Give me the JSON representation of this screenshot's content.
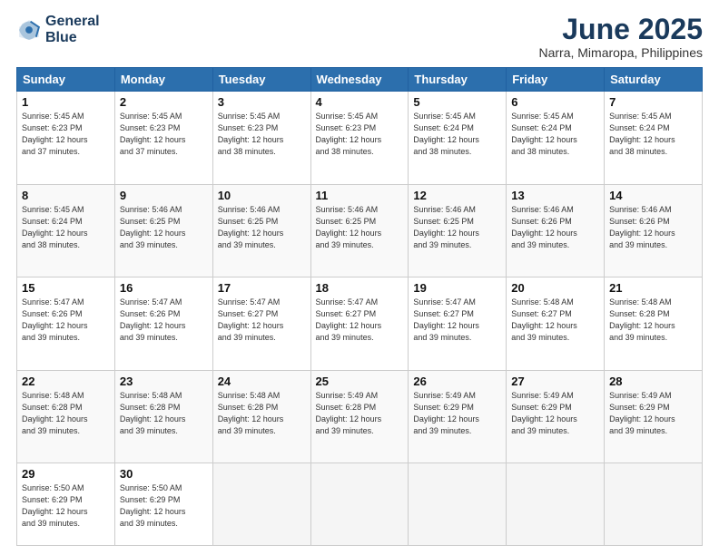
{
  "logo": {
    "line1": "General",
    "line2": "Blue"
  },
  "title": "June 2025",
  "location": "Narra, Mimaropa, Philippines",
  "headers": [
    "Sunday",
    "Monday",
    "Tuesday",
    "Wednesday",
    "Thursday",
    "Friday",
    "Saturday"
  ],
  "weeks": [
    [
      {
        "day": "1",
        "detail": "Sunrise: 5:45 AM\nSunset: 6:23 PM\nDaylight: 12 hours\nand 37 minutes."
      },
      {
        "day": "2",
        "detail": "Sunrise: 5:45 AM\nSunset: 6:23 PM\nDaylight: 12 hours\nand 37 minutes."
      },
      {
        "day": "3",
        "detail": "Sunrise: 5:45 AM\nSunset: 6:23 PM\nDaylight: 12 hours\nand 38 minutes."
      },
      {
        "day": "4",
        "detail": "Sunrise: 5:45 AM\nSunset: 6:23 PM\nDaylight: 12 hours\nand 38 minutes."
      },
      {
        "day": "5",
        "detail": "Sunrise: 5:45 AM\nSunset: 6:24 PM\nDaylight: 12 hours\nand 38 minutes."
      },
      {
        "day": "6",
        "detail": "Sunrise: 5:45 AM\nSunset: 6:24 PM\nDaylight: 12 hours\nand 38 minutes."
      },
      {
        "day": "7",
        "detail": "Sunrise: 5:45 AM\nSunset: 6:24 PM\nDaylight: 12 hours\nand 38 minutes."
      }
    ],
    [
      {
        "day": "8",
        "detail": "Sunrise: 5:45 AM\nSunset: 6:24 PM\nDaylight: 12 hours\nand 38 minutes."
      },
      {
        "day": "9",
        "detail": "Sunrise: 5:46 AM\nSunset: 6:25 PM\nDaylight: 12 hours\nand 39 minutes."
      },
      {
        "day": "10",
        "detail": "Sunrise: 5:46 AM\nSunset: 6:25 PM\nDaylight: 12 hours\nand 39 minutes."
      },
      {
        "day": "11",
        "detail": "Sunrise: 5:46 AM\nSunset: 6:25 PM\nDaylight: 12 hours\nand 39 minutes."
      },
      {
        "day": "12",
        "detail": "Sunrise: 5:46 AM\nSunset: 6:25 PM\nDaylight: 12 hours\nand 39 minutes."
      },
      {
        "day": "13",
        "detail": "Sunrise: 5:46 AM\nSunset: 6:26 PM\nDaylight: 12 hours\nand 39 minutes."
      },
      {
        "day": "14",
        "detail": "Sunrise: 5:46 AM\nSunset: 6:26 PM\nDaylight: 12 hours\nand 39 minutes."
      }
    ],
    [
      {
        "day": "15",
        "detail": "Sunrise: 5:47 AM\nSunset: 6:26 PM\nDaylight: 12 hours\nand 39 minutes."
      },
      {
        "day": "16",
        "detail": "Sunrise: 5:47 AM\nSunset: 6:26 PM\nDaylight: 12 hours\nand 39 minutes."
      },
      {
        "day": "17",
        "detail": "Sunrise: 5:47 AM\nSunset: 6:27 PM\nDaylight: 12 hours\nand 39 minutes."
      },
      {
        "day": "18",
        "detail": "Sunrise: 5:47 AM\nSunset: 6:27 PM\nDaylight: 12 hours\nand 39 minutes."
      },
      {
        "day": "19",
        "detail": "Sunrise: 5:47 AM\nSunset: 6:27 PM\nDaylight: 12 hours\nand 39 minutes."
      },
      {
        "day": "20",
        "detail": "Sunrise: 5:48 AM\nSunset: 6:27 PM\nDaylight: 12 hours\nand 39 minutes."
      },
      {
        "day": "21",
        "detail": "Sunrise: 5:48 AM\nSunset: 6:28 PM\nDaylight: 12 hours\nand 39 minutes."
      }
    ],
    [
      {
        "day": "22",
        "detail": "Sunrise: 5:48 AM\nSunset: 6:28 PM\nDaylight: 12 hours\nand 39 minutes."
      },
      {
        "day": "23",
        "detail": "Sunrise: 5:48 AM\nSunset: 6:28 PM\nDaylight: 12 hours\nand 39 minutes."
      },
      {
        "day": "24",
        "detail": "Sunrise: 5:48 AM\nSunset: 6:28 PM\nDaylight: 12 hours\nand 39 minutes."
      },
      {
        "day": "25",
        "detail": "Sunrise: 5:49 AM\nSunset: 6:28 PM\nDaylight: 12 hours\nand 39 minutes."
      },
      {
        "day": "26",
        "detail": "Sunrise: 5:49 AM\nSunset: 6:29 PM\nDaylight: 12 hours\nand 39 minutes."
      },
      {
        "day": "27",
        "detail": "Sunrise: 5:49 AM\nSunset: 6:29 PM\nDaylight: 12 hours\nand 39 minutes."
      },
      {
        "day": "28",
        "detail": "Sunrise: 5:49 AM\nSunset: 6:29 PM\nDaylight: 12 hours\nand 39 minutes."
      }
    ],
    [
      {
        "day": "29",
        "detail": "Sunrise: 5:50 AM\nSunset: 6:29 PM\nDaylight: 12 hours\nand 39 minutes."
      },
      {
        "day": "30",
        "detail": "Sunrise: 5:50 AM\nSunset: 6:29 PM\nDaylight: 12 hours\nand 39 minutes."
      },
      {
        "day": "",
        "detail": ""
      },
      {
        "day": "",
        "detail": ""
      },
      {
        "day": "",
        "detail": ""
      },
      {
        "day": "",
        "detail": ""
      },
      {
        "day": "",
        "detail": ""
      }
    ]
  ]
}
